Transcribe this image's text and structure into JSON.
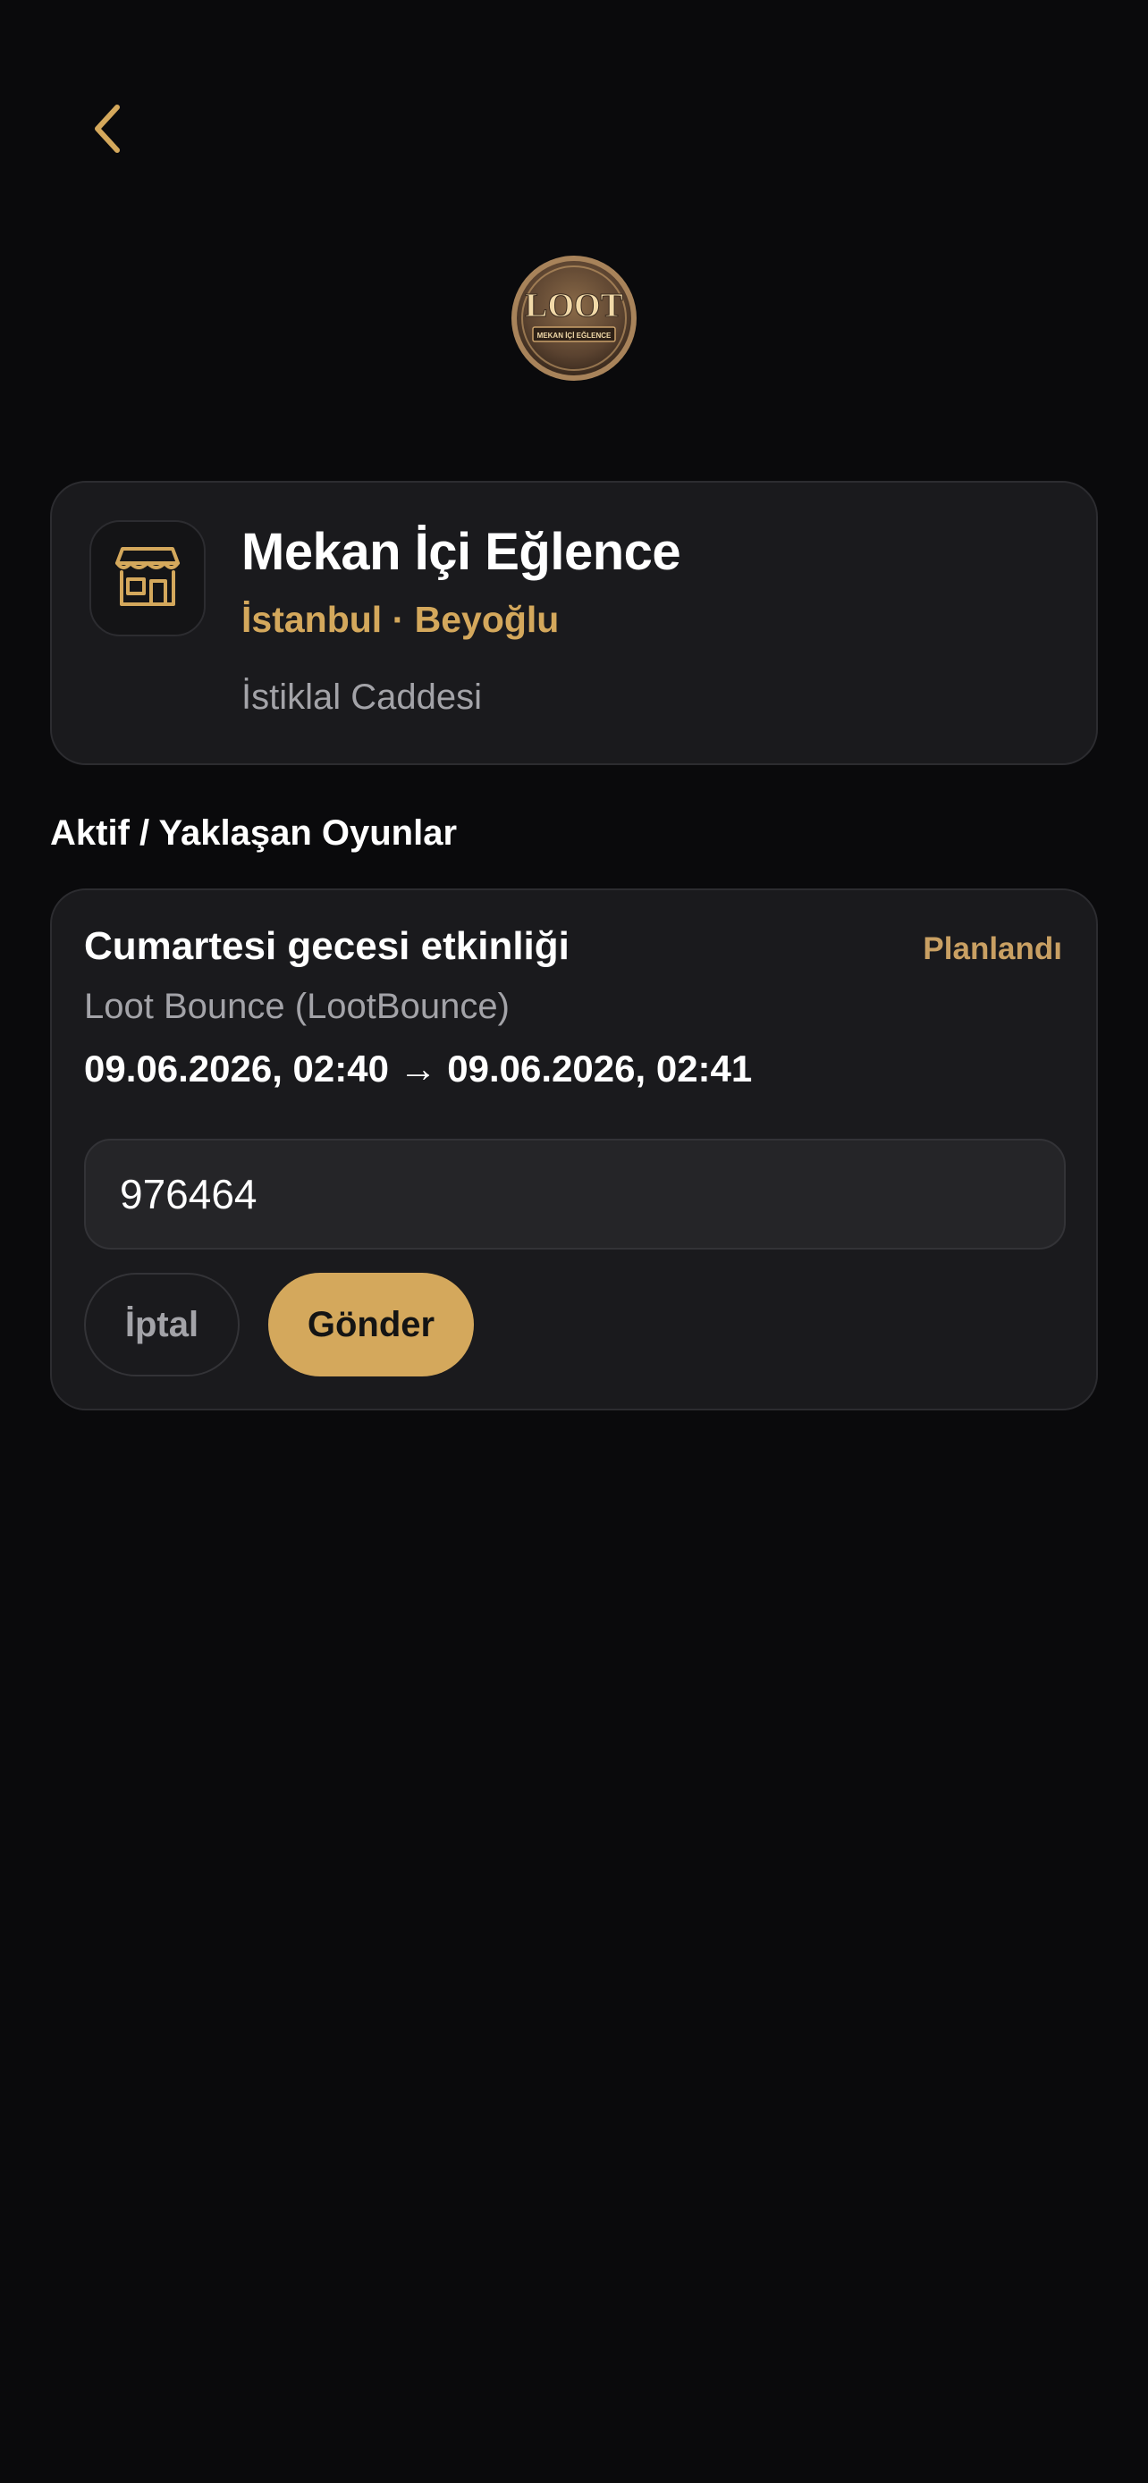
{
  "colors": {
    "background": "#0a0a0c",
    "card": "#1a1a1d",
    "accent": "#d4a85c",
    "muted_text": "#a3a3a8",
    "status": "#c9a063"
  },
  "header": {
    "back_icon": "chevron-left-icon",
    "logo": {
      "name": "loot-logo",
      "text_main": "LOOT",
      "text_sub": "MEKAN İÇİ EĞLENCE"
    }
  },
  "venue": {
    "icon": "store-icon",
    "name": "Mekan İçi Eğlence",
    "location": "İstanbul · Beyoğlu",
    "street": "İstiklal Caddesi"
  },
  "games_section": {
    "title": "Aktif / Yaklaşan Oyunlar"
  },
  "game": {
    "title": "Cumartesi gecesi etkinliği",
    "status": "Planlandı",
    "subtitle": "Loot Bounce (LootBounce)",
    "time_range": "09.06.2026, 02:40 → 09.06.2026, 02:41",
    "code_value": "976464",
    "cancel_label": "İptal",
    "send_label": "Gönder"
  }
}
